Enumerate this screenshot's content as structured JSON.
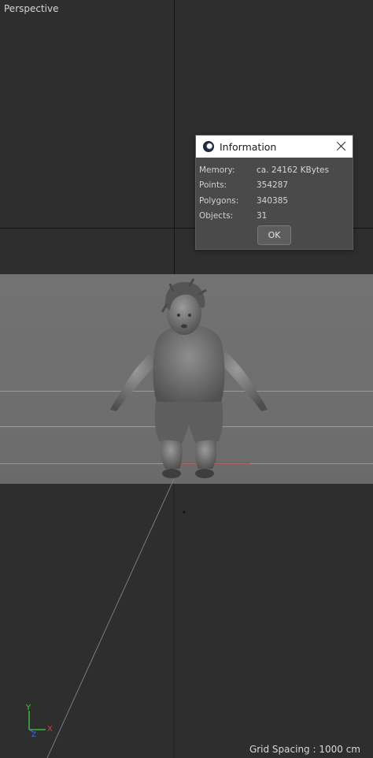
{
  "viewport": {
    "label": "Perspective",
    "grid_spacing": "Grid Spacing : 1000 cm",
    "axes": {
      "y": "Y",
      "x": "X",
      "z": "Z"
    }
  },
  "dialog": {
    "title": "Information",
    "icon": "cinema4d-logo-icon",
    "rows": [
      {
        "label": "Memory:",
        "value": "ca. 24162 KBytes"
      },
      {
        "label": "Points:",
        "value": "354287"
      },
      {
        "label": "Polygons:",
        "value": "340385"
      },
      {
        "label": "Objects:",
        "value": "31"
      }
    ],
    "ok_label": "OK"
  },
  "colors": {
    "background": "#2e2e2e",
    "floor": "#6f6f6f",
    "axis_x": "#e23b3b",
    "axis_y": "#3bd13b",
    "axis_z": "#3b6fe2"
  }
}
